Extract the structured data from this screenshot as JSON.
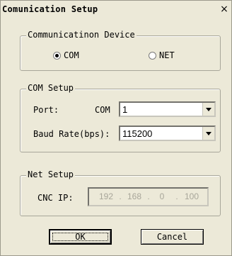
{
  "window": {
    "title": "Comunication Setup",
    "close_symbol": "×"
  },
  "device_group": {
    "title": "Communicatinon Device",
    "options": [
      {
        "label": "COM",
        "selected": true
      },
      {
        "label": "NET",
        "selected": false
      }
    ]
  },
  "com_group": {
    "title": "COM Setup",
    "port_label": "Port:",
    "port_prefix": "COM",
    "port_value": "1",
    "baud_label": "Baud Rate(bps):",
    "baud_value": "115200"
  },
  "net_group": {
    "title": "Net Setup",
    "ip_label": "CNC IP:",
    "ip_octets": [
      "192",
      "168",
      "0",
      "100"
    ],
    "ip_separator": "."
  },
  "buttons": {
    "ok": "OK",
    "cancel": "Cancel"
  }
}
